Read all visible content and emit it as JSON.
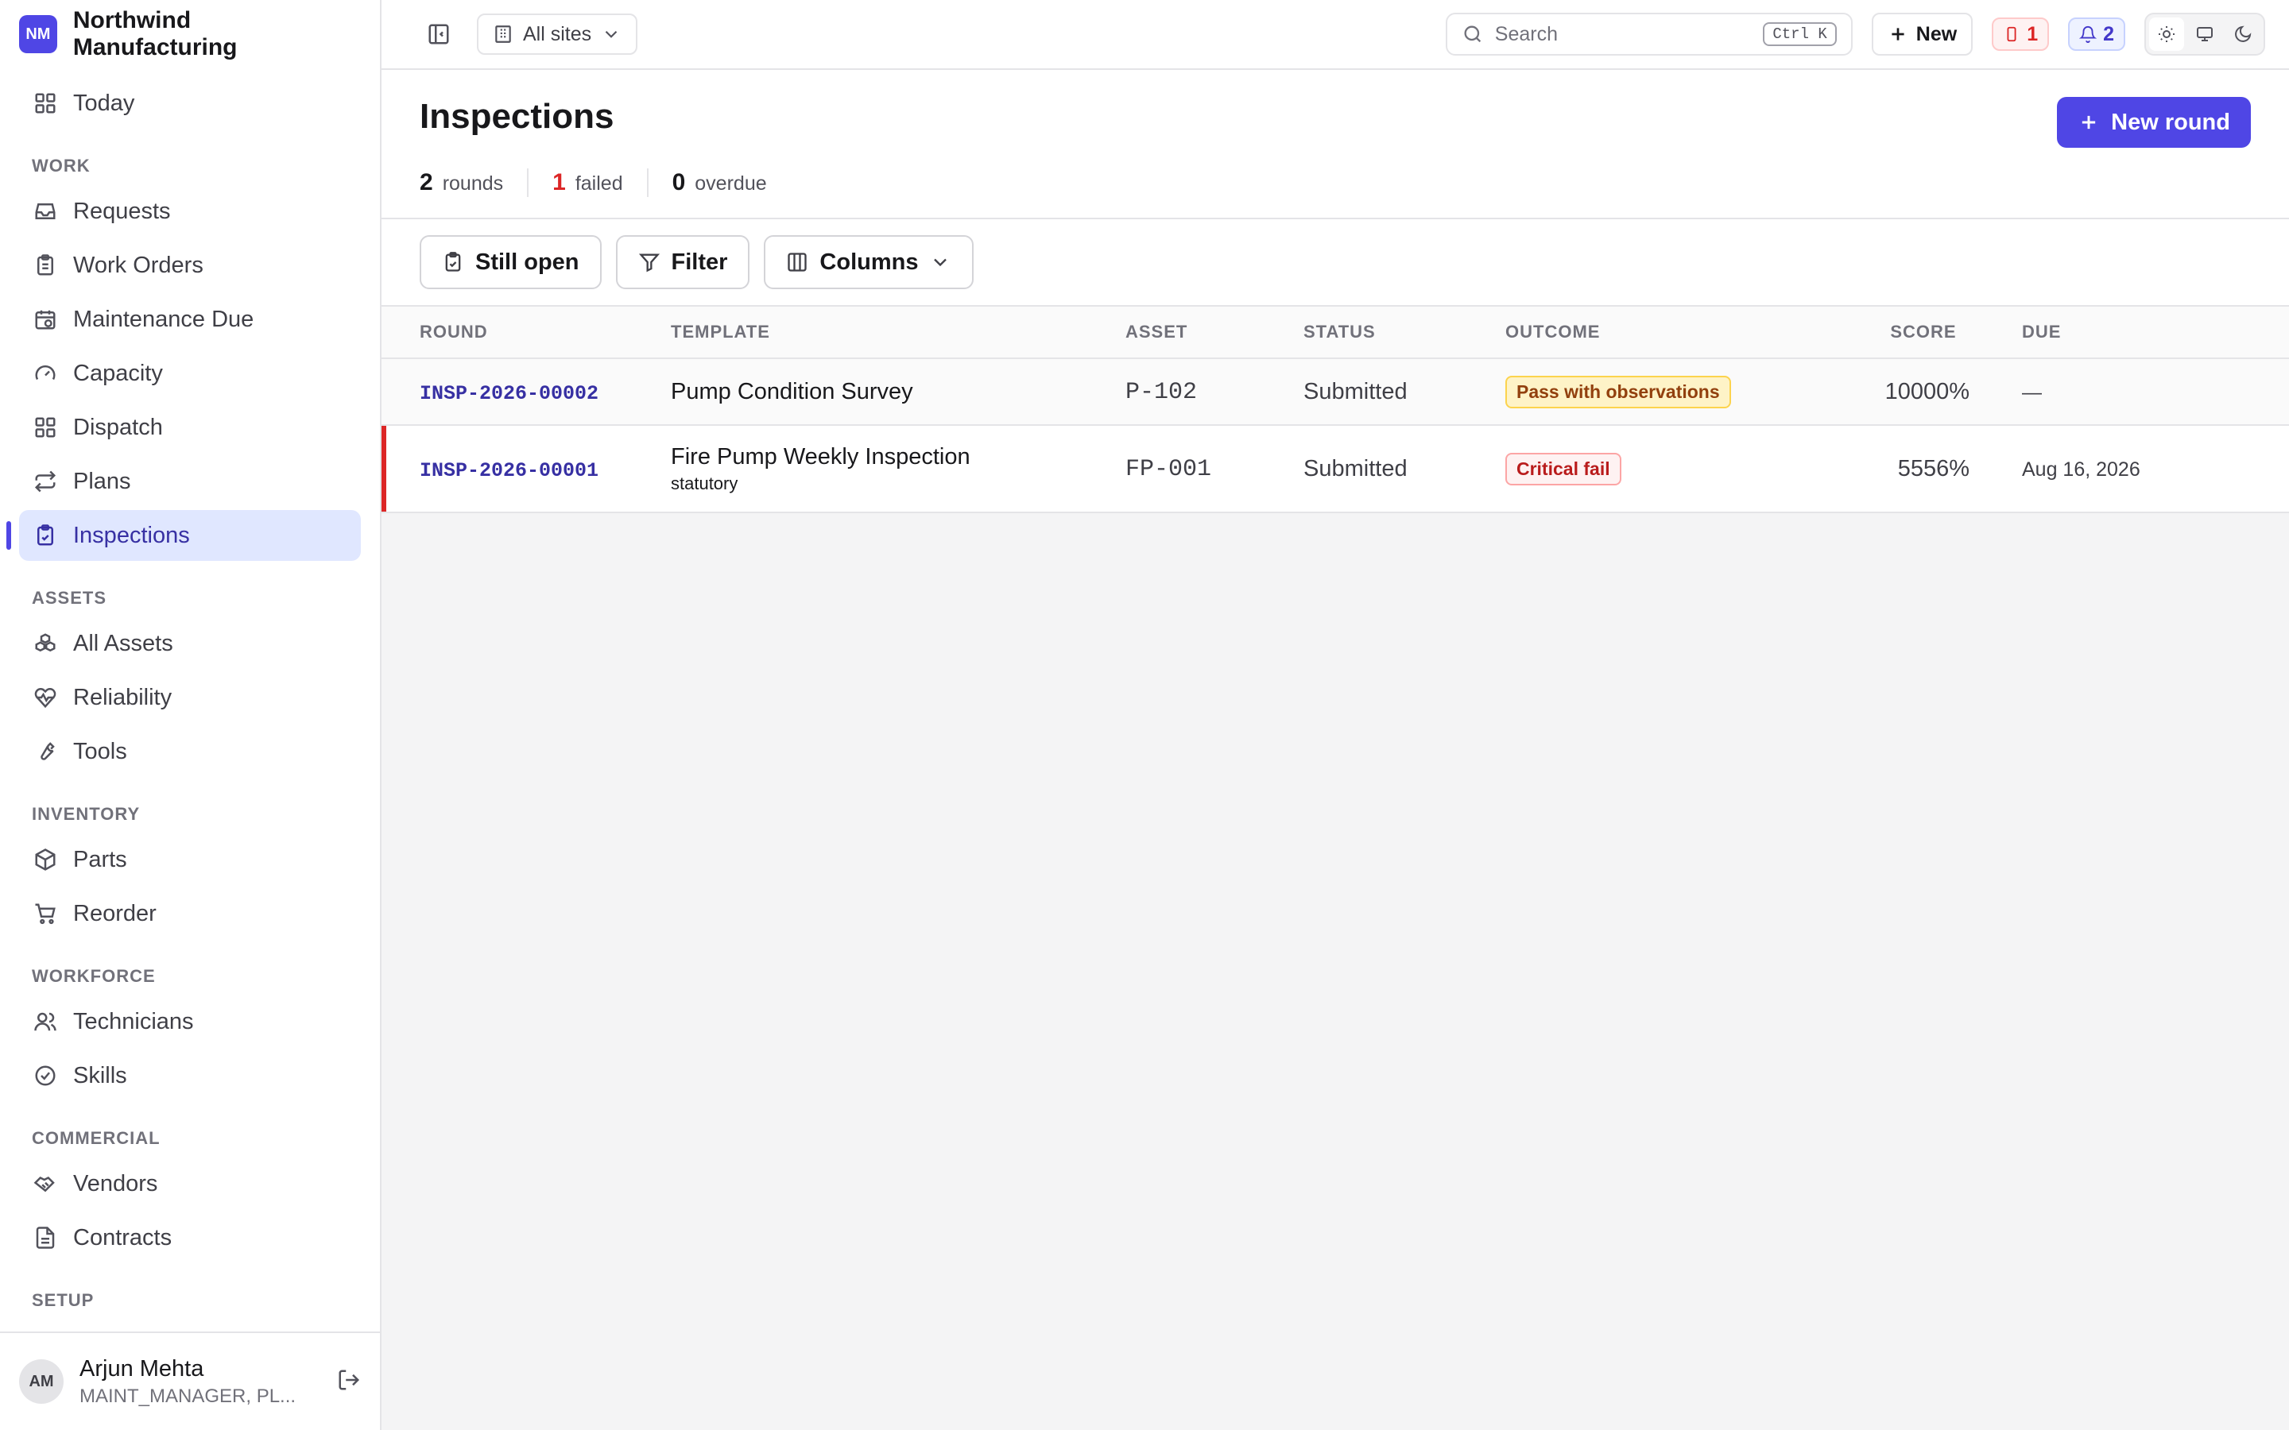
{
  "brand": {
    "initials": "NM",
    "name": "Northwind Manufacturing"
  },
  "sidebar": {
    "today": "Today",
    "sections": {
      "work": "WORK",
      "assets": "ASSETS",
      "inventory": "INVENTORY",
      "workforce": "WORKFORCE",
      "commercial": "COMMERCIAL",
      "setup": "SETUP"
    },
    "items": {
      "requests": "Requests",
      "work_orders": "Work Orders",
      "maintenance_due": "Maintenance Due",
      "capacity": "Capacity",
      "dispatch": "Dispatch",
      "plans": "Plans",
      "inspections": "Inspections",
      "all_assets": "All Assets",
      "reliability": "Reliability",
      "tools": "Tools",
      "parts": "Parts",
      "reorder": "Reorder",
      "technicians": "Technicians",
      "skills": "Skills",
      "vendors": "Vendors",
      "contracts": "Contracts"
    },
    "active": "inspections"
  },
  "user": {
    "initials": "AM",
    "name": "Arjun Mehta",
    "role": "MAINT_MANAGER, PL..."
  },
  "topbar": {
    "site_select": "All sites",
    "search_placeholder": "Search",
    "search_shortcut": "Ctrl K",
    "new_label": "New",
    "alert_count": "1",
    "notification_count": "2"
  },
  "page": {
    "title": "Inspections",
    "new_round_label": "New round",
    "stats": [
      {
        "value": "2",
        "label": "rounds"
      },
      {
        "value": "1",
        "label": "failed"
      },
      {
        "value": "0",
        "label": "overdue"
      }
    ]
  },
  "toolbar": {
    "still_open": "Still open",
    "filter": "Filter",
    "columns": "Columns"
  },
  "table": {
    "columns": [
      "ROUND",
      "TEMPLATE",
      "ASSET",
      "STATUS",
      "OUTCOME",
      "SCORE",
      "DUE"
    ],
    "rows": [
      {
        "round": "INSP-2026-00002",
        "template": "Pump Condition Survey",
        "template_sub": "",
        "asset": "P-102",
        "status": "Submitted",
        "outcome": "Pass with observations",
        "score": "10000%",
        "due": "—"
      },
      {
        "round": "INSP-2026-00001",
        "template": "Fire Pump Weekly Inspection",
        "template_sub": "statutory",
        "asset": "FP-001",
        "status": "Submitted",
        "outcome": "Critical fail",
        "score": "5556%",
        "due": "Aug 16, 2026"
      }
    ]
  },
  "colors": {
    "accent": "#4f46e5",
    "fail": "#dc2626",
    "warning_bg": "#fef3c7"
  }
}
